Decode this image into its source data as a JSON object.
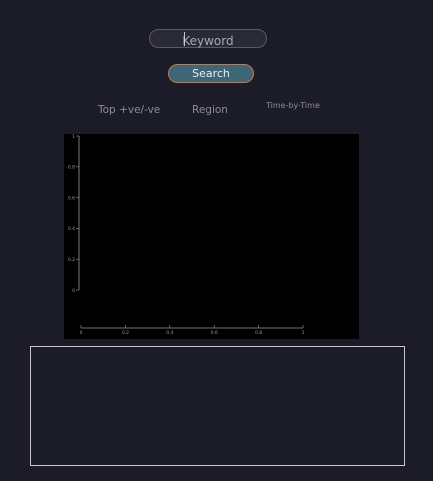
{
  "search": {
    "placeholder": "Keyword",
    "button_label": "Search"
  },
  "tabs": [
    {
      "label": "Top +ve/-ve"
    },
    {
      "label": "Region"
    },
    {
      "label": "Time-by-Time"
    }
  ],
  "chart_data": {
    "type": "line",
    "title": "",
    "xlabel": "",
    "ylabel": "",
    "x_ticks": [
      "0",
      "0.2",
      "0.4",
      "0.6",
      "0.8",
      "1"
    ],
    "y_ticks": [
      "0",
      "0.2",
      "0.4",
      "0.6",
      "0.8",
      "1"
    ],
    "xlim": [
      0,
      1
    ],
    "ylim": [
      0,
      1
    ],
    "series": [],
    "grid": false
  },
  "colors": {
    "background": "#1c1b28",
    "chart_background": "#000000",
    "axis": "#9a9aa0",
    "button_fill": "#3f6677",
    "button_border": "#c87a3c"
  }
}
